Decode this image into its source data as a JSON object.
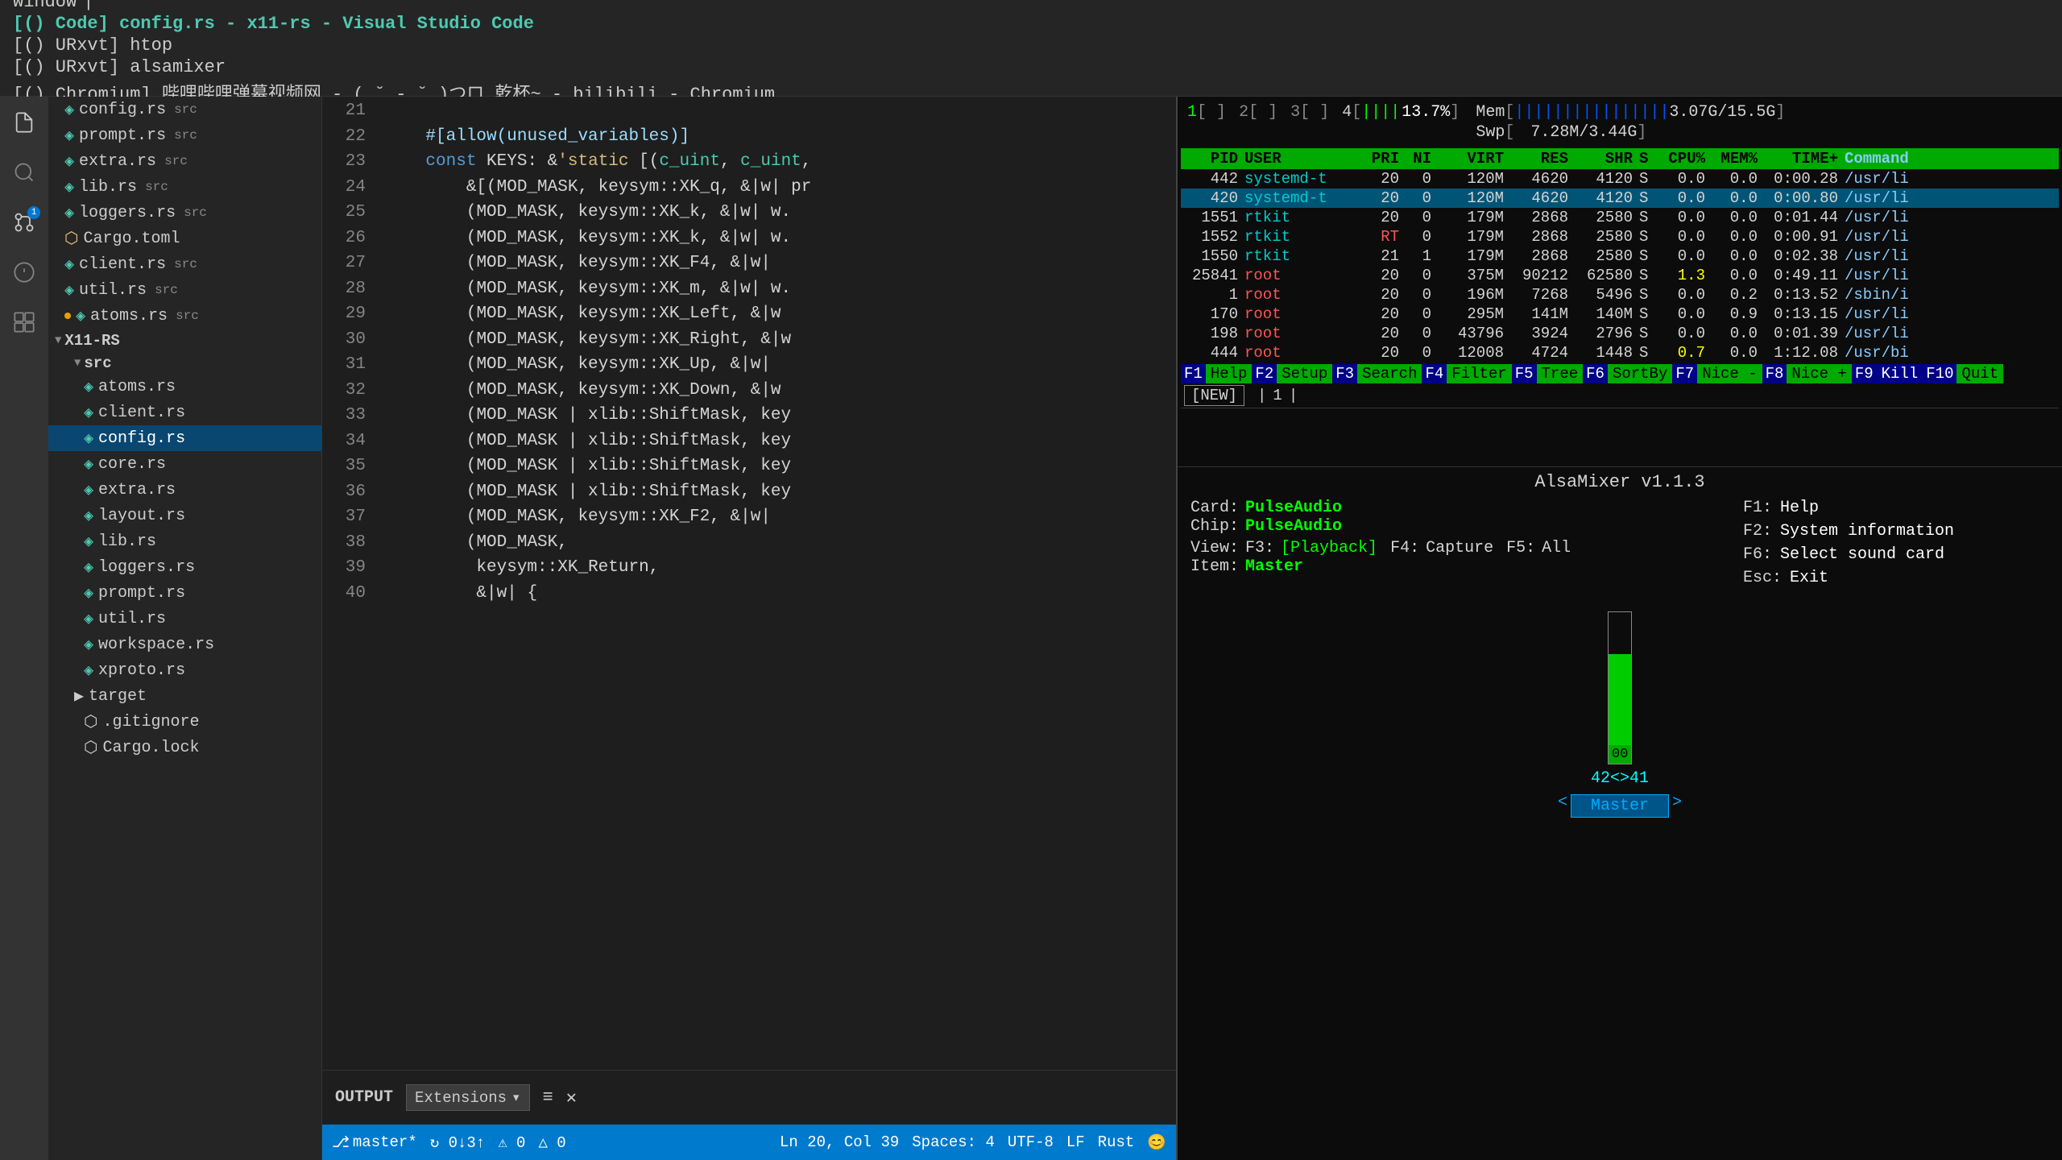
{
  "topbar": {
    "cursor": "|",
    "window_label": "window",
    "tabs": [
      {
        "text": "[() Code] config.rs - x11-rs - Visual Studio Code",
        "active": true
      },
      {
        "text": "[() URxvt] htop",
        "active": false
      },
      {
        "text": "[() URxvt] alsamixer",
        "active": false
      },
      {
        "text": "[() Chromium] 哔哩哔哩弹幕视频网 - ( ˘ - ˘ )つロ 乾杯~ - bilibili - Chromium",
        "active": false
      }
    ]
  },
  "sidebar": {
    "files": [
      {
        "name": "config.rs",
        "tag": "src",
        "active": false
      },
      {
        "name": "prompt.rs",
        "tag": "src",
        "active": false
      },
      {
        "name": "extra.rs",
        "tag": "src",
        "active": false
      },
      {
        "name": "lib.rs",
        "tag": "src",
        "active": false
      },
      {
        "name": "loggers.rs",
        "tag": "src",
        "active": false
      },
      {
        "name": "Cargo.toml",
        "tag": "",
        "active": false
      },
      {
        "name": "client.rs",
        "tag": "src",
        "active": false
      },
      {
        "name": "util.rs",
        "tag": "src",
        "active": false
      },
      {
        "name": "atoms.rs",
        "tag": "src",
        "dot": true,
        "active": false
      }
    ],
    "group": "X11-RS",
    "src_files": [
      {
        "name": "atoms.rs",
        "active": false
      },
      {
        "name": "client.rs",
        "active": false
      },
      {
        "name": "config.rs",
        "active": true
      },
      {
        "name": "core.rs",
        "active": false
      },
      {
        "name": "extra.rs",
        "active": false
      },
      {
        "name": "layout.rs",
        "active": false
      },
      {
        "name": "lib.rs",
        "active": false
      },
      {
        "name": "loggers.rs",
        "active": false
      },
      {
        "name": "prompt.rs",
        "active": false
      },
      {
        "name": "util.rs",
        "active": false
      },
      {
        "name": "workspace.rs",
        "active": false
      },
      {
        "name": "xproto.rs",
        "active": false
      }
    ],
    "target": "target",
    "gitignore": ".gitignore",
    "cargo_lock": "Cargo.lock"
  },
  "editor": {
    "lines": [
      {
        "num": "21",
        "code": ""
      },
      {
        "num": "22",
        "code": "    #[allow(unused_variables)]"
      },
      {
        "num": "23",
        "code": "    const KEYS: &'static [(c_uint, c_uint,"
      },
      {
        "num": "24",
        "code": "        &[(MOD_MASK, keysym::XK_q, &|w| pr"
      },
      {
        "num": "25",
        "code": "        (MOD_MASK, keysym::XK_k, &|w| w."
      },
      {
        "num": "26",
        "code": "        (MOD_MASK, keysym::XK_k, &|w| w."
      },
      {
        "num": "27",
        "code": "        (MOD_MASK, keysym::XK_F4, &|w|"
      },
      {
        "num": "28",
        "code": "        (MOD_MASK, keysym::XK_m, &|w| w."
      },
      {
        "num": "29",
        "code": "        (MOD_MASK, keysym::XK_Left, &|w"
      },
      {
        "num": "30",
        "code": "        (MOD_MASK, keysym::XK_Right, &|w"
      },
      {
        "num": "31",
        "code": "        (MOD_MASK, keysym::XK_Up, &|w|"
      },
      {
        "num": "32",
        "code": "        (MOD_MASK, keysym::XK_Down, &|w"
      },
      {
        "num": "33",
        "code": "        (MOD_MASK | xlib::ShiftMask, key"
      },
      {
        "num": "34",
        "code": "        (MOD_MASK | xlib::ShiftMask, key"
      },
      {
        "num": "35",
        "code": "        (MOD_MASK | xlib::ShiftMask, key"
      },
      {
        "num": "36",
        "code": "        (MOD_MASK | xlib::ShiftMask, key"
      },
      {
        "num": "37",
        "code": "        (MOD_MASK, keysym::XK_F2, &|w|"
      },
      {
        "num": "38",
        "code": "        (MOD_MASK,"
      },
      {
        "num": "39",
        "code": "         keysym::XK_Return,"
      },
      {
        "num": "40",
        "code": "         &|w| {"
      }
    ],
    "output_label": "OUTPUT",
    "output_dropdown": "Extensions"
  },
  "statusbar": {
    "branch": "master*",
    "sync": "↻ 0↓3↑",
    "errors": "⚠ 0",
    "warnings": "△ 0",
    "ln_col": "Ln 20, Col 39",
    "spaces": "Spaces: 4",
    "encoding": "UTF-8",
    "line_ending": "LF",
    "lang": "Rust",
    "emoji": "😊"
  },
  "htop": {
    "cpu_bars": [
      {
        "id": "1",
        "bar": "   ",
        "pct": ""
      },
      {
        "id": "2",
        "bar": "   ",
        "pct": ""
      },
      {
        "id": "3",
        "bar": "   ",
        "pct": ""
      },
      {
        "id": "4",
        "bar": "||||",
        "pct": "13.7%"
      }
    ],
    "mem_bar": "||||||||||||||||",
    "mem_used": "3.07G",
    "mem_total": "15.5G",
    "swp_used": "7.28M",
    "swp_total": "3.44G",
    "columns": [
      "PID",
      "USER",
      "PRI",
      "NI",
      "VIRT",
      "RES",
      "SHR",
      "S",
      "CPU%",
      "MEM%",
      "TIME+",
      "Command"
    ],
    "processes": [
      {
        "pid": "442",
        "user": "systemd-t",
        "pri": "20",
        "ni": "0",
        "virt": "120M",
        "res": "4620",
        "shr": "4120",
        "s": "S",
        "cpu": "0.0",
        "mem": "0.0",
        "time": "0:00.28",
        "cmd": "/usr/li"
      },
      {
        "pid": "420",
        "user": "systemd-t",
        "pri": "20",
        "ni": "0",
        "virt": "120M",
        "res": "4620",
        "shr": "4120",
        "s": "S",
        "cpu": "0.0",
        "mem": "0.0",
        "time": "0:00.80",
        "cmd": "/usr/li",
        "highlight": true
      },
      {
        "pid": "1551",
        "user": "rtkit",
        "pri": "20",
        "ni": "0",
        "virt": "179M",
        "res": "2868",
        "shr": "2580",
        "s": "S",
        "cpu": "0.0",
        "mem": "0.0",
        "time": "0:01.44",
        "cmd": "/usr/li"
      },
      {
        "pid": "1552",
        "user": "rtkit",
        "pri": "RT",
        "ni": "0",
        "virt": "179M",
        "res": "2868",
        "shr": "2580",
        "s": "S",
        "cpu": "0.0",
        "mem": "0.0",
        "time": "0:00.91",
        "cmd": "/usr/li"
      },
      {
        "pid": "1550",
        "user": "rtkit",
        "pri": "21",
        "ni": "1",
        "virt": "179M",
        "res": "2868",
        "shr": "2580",
        "s": "S",
        "cpu": "0.0",
        "mem": "0.0",
        "time": "0:02.38",
        "cmd": "/usr/li"
      },
      {
        "pid": "25841",
        "user": "root",
        "pri": "20",
        "ni": "0",
        "virt": "375M",
        "res": "90212",
        "shr": "62580",
        "s": "S",
        "cpu": "1.3",
        "mem": "0.0",
        "time": "0:49.11",
        "cmd": "/usr/li"
      },
      {
        "pid": "1",
        "user": "root",
        "pri": "20",
        "ni": "0",
        "virt": "196M",
        "res": "7268",
        "shr": "5496",
        "s": "S",
        "cpu": "0.0",
        "mem": "0.2",
        "time": "0:13.52",
        "cmd": "/sbin/i"
      },
      {
        "pid": "170",
        "user": "root",
        "pri": "20",
        "ni": "0",
        "virt": "295M",
        "res": "141M",
        "shr": "140M",
        "s": "S",
        "cpu": "0.0",
        "mem": "0.9",
        "time": "0:13.15",
        "cmd": "/usr/li"
      },
      {
        "pid": "198",
        "user": "root",
        "pri": "20",
        "ni": "0",
        "virt": "43796",
        "res": "3924",
        "shr": "2796",
        "s": "S",
        "cpu": "0.0",
        "mem": "0.0",
        "time": "0:01.39",
        "cmd": "/usr/li"
      },
      {
        "pid": "444",
        "user": "root",
        "pri": "20",
        "ni": "0",
        "virt": "12008",
        "res": "4724",
        "shr": "1448",
        "s": "S",
        "cpu": "0.7",
        "mem": "0.0",
        "time": "1:12.08",
        "cmd": "/usr/bi"
      }
    ],
    "fn_bar": [
      {
        "num": "F1",
        "label": "Help"
      },
      {
        "num": "F2",
        "label": "Setup"
      },
      {
        "num": "F3",
        "label": "Search"
      },
      {
        "num": "F4",
        "label": "Filter"
      },
      {
        "num": "F5",
        "label": "Tree"
      },
      {
        "num": "F6",
        "label": "SortBy"
      },
      {
        "num": "F7",
        "label": "Nice -"
      },
      {
        "num": "F8",
        "label": "Nice +"
      },
      {
        "num": "F9",
        "label": "Kill"
      },
      {
        "num": "F10",
        "label": "Quit"
      }
    ],
    "new_tab": "[NEW]",
    "tab_num": "1"
  },
  "alsamixer": {
    "title": "AlsaMixer v1.1.3",
    "card_label": "Card:",
    "card_val": "PulseAudio",
    "chip_label": "Chip:",
    "chip_val": "PulseAudio",
    "view_label": "View:",
    "view_f3": "F3:",
    "view_playback": "[Playback]",
    "view_f4": "F4:",
    "view_capture": "Capture",
    "view_f5": "F5:",
    "view_all": "All",
    "item_label": "Item:",
    "item_val": "Master",
    "f1_label": "F1:",
    "f1_val": "Help",
    "f2_label": "F2:",
    "f2_val": "System information",
    "f6_label": "F6:",
    "f6_val": "Select sound card",
    "esc_label": "Esc:",
    "esc_val": "Exit",
    "volume": "42<>41",
    "channel": "Master",
    "channel_arrows": "< Master >",
    "fader_pct": 80,
    "knob_label": "00"
  }
}
